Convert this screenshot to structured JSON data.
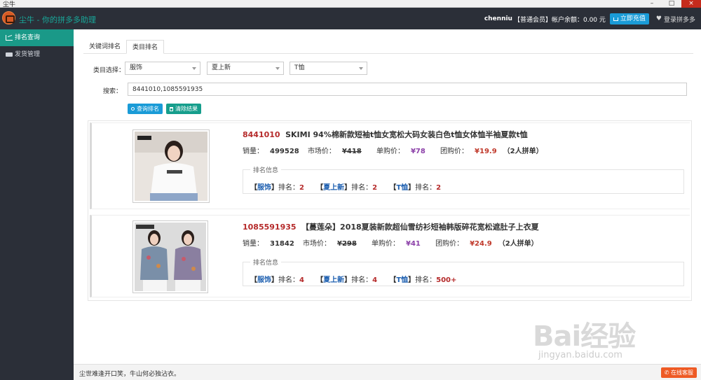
{
  "os_window": {
    "title": "尘牛"
  },
  "app": {
    "title": "尘牛 - 你的拼多多助理"
  },
  "user": {
    "name": "chenniu",
    "level": "【普通会员】",
    "balance": "帐户余额：0.00 元",
    "recharge_label": "立即充值",
    "login_label": "登录拼多多"
  },
  "sidebar": {
    "items": [
      {
        "label": "排名查询"
      },
      {
        "label": "发货管理"
      }
    ]
  },
  "tabs": [
    {
      "label": "关键词排名"
    },
    {
      "label": "类目排名"
    }
  ],
  "filter": {
    "category_label": "类目选择：",
    "cat1": "服饰",
    "cat2": "夏上新",
    "cat3": "T恤",
    "search_label": "搜索：",
    "search_value": "8441010,1085591935",
    "query_button": "查询排名",
    "clear_button": "清除结果"
  },
  "results": [
    {
      "id": "8441010",
      "name": "SKIMI 94%棉新款短袖t恤女宽松大码女装白色t恤女体恤半袖夏款t恤",
      "sales_label": "销量：",
      "sales": "499528",
      "market_label": "市场价：",
      "market_price": "¥418",
      "single_label": "单购价：",
      "single_price": "¥78",
      "group_label": "团购价：",
      "group_price": "¥19.9",
      "group_note": "（2人拼单）",
      "rank_title": "排名信息",
      "ranks": [
        {
          "cat": "服饰",
          "label": "排名：",
          "value": "2"
        },
        {
          "cat": "夏上新",
          "label": "排名：",
          "value": "2"
        },
        {
          "cat": "T恤",
          "label": "排名：",
          "value": "2"
        }
      ]
    },
    {
      "id": "1085591935",
      "name": "【蔓莲朵】2018夏装新款超仙雪纺衫短袖韩版碎花宽松遮肚子上衣夏",
      "sales_label": "销量：",
      "sales": "31842",
      "market_label": "市场价：",
      "market_price": "¥298",
      "single_label": "单购价：",
      "single_price": "¥41",
      "group_label": "团购价：",
      "group_price": "¥24.9",
      "group_note": "（2人拼单）",
      "rank_title": "排名信息",
      "ranks": [
        {
          "cat": "服饰",
          "label": "排名：",
          "value": "4"
        },
        {
          "cat": "夏上新",
          "label": "排名：",
          "value": "4"
        },
        {
          "cat": "T恤",
          "label": "排名：",
          "value": "500+"
        }
      ]
    }
  ],
  "footer": {
    "quote": "尘世难逢开口笑，牛山何必独沾衣。",
    "service_label": "在线客服"
  },
  "watermark": {
    "brand": "Bai经验",
    "url": "jingyan.baidu.com"
  },
  "colors": {
    "header_bg": "#2b2f38",
    "sidebar_active": "#1a9988",
    "accent_blue": "#1a9bd7",
    "price_purple": "#8b3fa8",
    "price_red": "#c0392b",
    "service_orange": "#ee5a24"
  }
}
